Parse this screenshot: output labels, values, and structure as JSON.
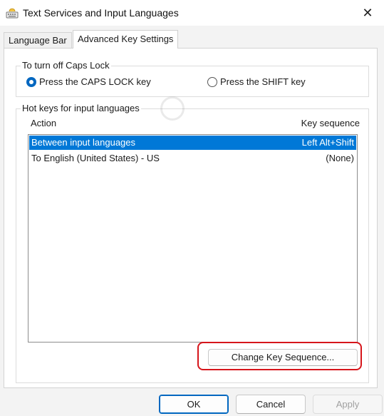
{
  "window": {
    "title": "Text Services and Input Languages",
    "close_glyph": "✕"
  },
  "tabs": [
    {
      "label": "Language Bar",
      "active": false
    },
    {
      "label": "Advanced Key Settings",
      "active": true
    }
  ],
  "caps_lock": {
    "legend": "To turn off Caps Lock",
    "options": [
      {
        "label": "Press the CAPS LOCK key",
        "selected": true
      },
      {
        "label": "Press the SHIFT key",
        "selected": false
      }
    ]
  },
  "hotkeys": {
    "legend": "Hot keys for input languages",
    "columns": {
      "action": "Action",
      "key_sequence": "Key sequence"
    },
    "rows": [
      {
        "action": "Between input languages",
        "key_sequence": "Left Alt+Shift",
        "selected": true
      },
      {
        "action": "To English (United States) - US",
        "key_sequence": "(None)",
        "selected": false
      }
    ],
    "change_button": "Change Key Sequence..."
  },
  "buttons": {
    "ok": "OK",
    "cancel": "Cancel",
    "apply": "Apply"
  },
  "colors": {
    "accent": "#0078d7",
    "highlight": "#d6151b"
  }
}
